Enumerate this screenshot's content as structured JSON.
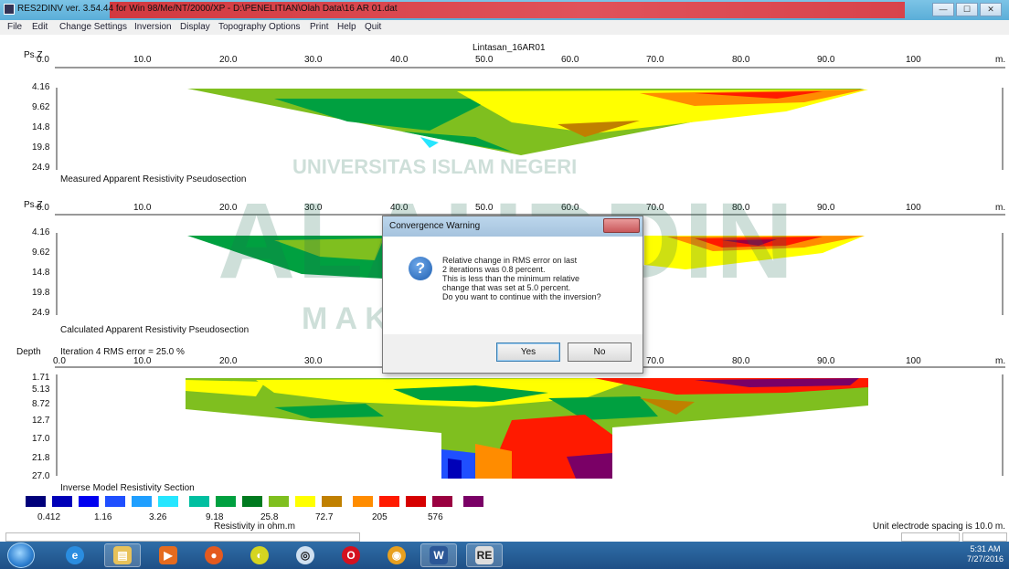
{
  "window": {
    "title": "RES2DINV ver. 3.54.44 for Win 98/Me/NT/2000/XP - D:\\PENELITIAN\\Olah Data\\16 AR 01.dat",
    "btn_min": "—",
    "btn_max": "☐",
    "btn_close": "✕"
  },
  "menu": [
    "File",
    "Edit",
    "Change Settings",
    "Inversion",
    "Display",
    "Topography Options",
    "Print",
    "Help",
    "Quit"
  ],
  "line_name": "Lintasan_16AR01",
  "x_ticks": [
    "0.0",
    "10.0",
    "20.0",
    "30.0",
    "40.0",
    "50.0",
    "60.0",
    "70.0",
    "80.0",
    "90.0",
    "100"
  ],
  "x_unit": "m.",
  "panels": [
    {
      "axis_title": "Ps.Z",
      "y_labels": [
        "4.16",
        "9.62",
        "14.8",
        "19.8",
        "24.9"
      ],
      "caption": "Measured Apparent Resistivity Pseudosection"
    },
    {
      "axis_title": "Ps.Z",
      "y_labels": [
        "4.16",
        "9.62",
        "14.8",
        "19.8",
        "24.9"
      ],
      "caption": "Calculated Apparent Resistivity Pseudosection"
    },
    {
      "axis_title": "Depth",
      "iteration": "Iteration 4 RMS error = 25.0 %",
      "y_labels": [
        "1.71",
        "5.13",
        "8.72",
        "12.7",
        "17.0",
        "21.8",
        "27.0"
      ],
      "caption": "Inverse Model Resistivity Section"
    }
  ],
  "dialog": {
    "title": "Convergence Warning",
    "lines": [
      "Relative change in RMS error on last",
      "2 iterations was 0.8 percent.",
      "This is less than the minimum relative",
      "change that was set at 5.0 percent.",
      "Do you want to continue with the inversion?"
    ],
    "yes": "Yes",
    "no": "No",
    "icon": "question-icon"
  },
  "legend": {
    "colors": [
      "#00007a",
      "#0000b8",
      "#0000f0",
      "#1f4fff",
      "#1f9fff",
      "#26e6ff",
      "#00bfa0",
      "#00a040",
      "#007a1f",
      "#7fbf1f",
      "#ffff00",
      "#c08000",
      "#ff8c00",
      "#ff1a00",
      "#d60000",
      "#9a0040",
      "#7a0066"
    ],
    "values": [
      "0.412",
      "1.16",
      "3.26",
      "9.18",
      "25.8",
      "72.7",
      "205",
      "576"
    ],
    "unit": "Resistivity in ohm.m"
  },
  "unit_spacing": "Unit electrode spacing is 10.0 m.",
  "watermark": {
    "line1": "UNIVERSITAS ISLAM NEGERI",
    "line2": "ALAUDDIN",
    "line3": "M A K A S S A R"
  },
  "taskbar": {
    "icons": [
      "ie-icon",
      "explorer-icon",
      "media-icon",
      "firefox-icon",
      "app-icon",
      "chrome-like-icon",
      "opera-icon",
      "chrome-icon",
      "word-icon",
      "res2dinv-icon"
    ],
    "clock_time": "5:31 AM",
    "clock_date": "7/27/2016"
  }
}
